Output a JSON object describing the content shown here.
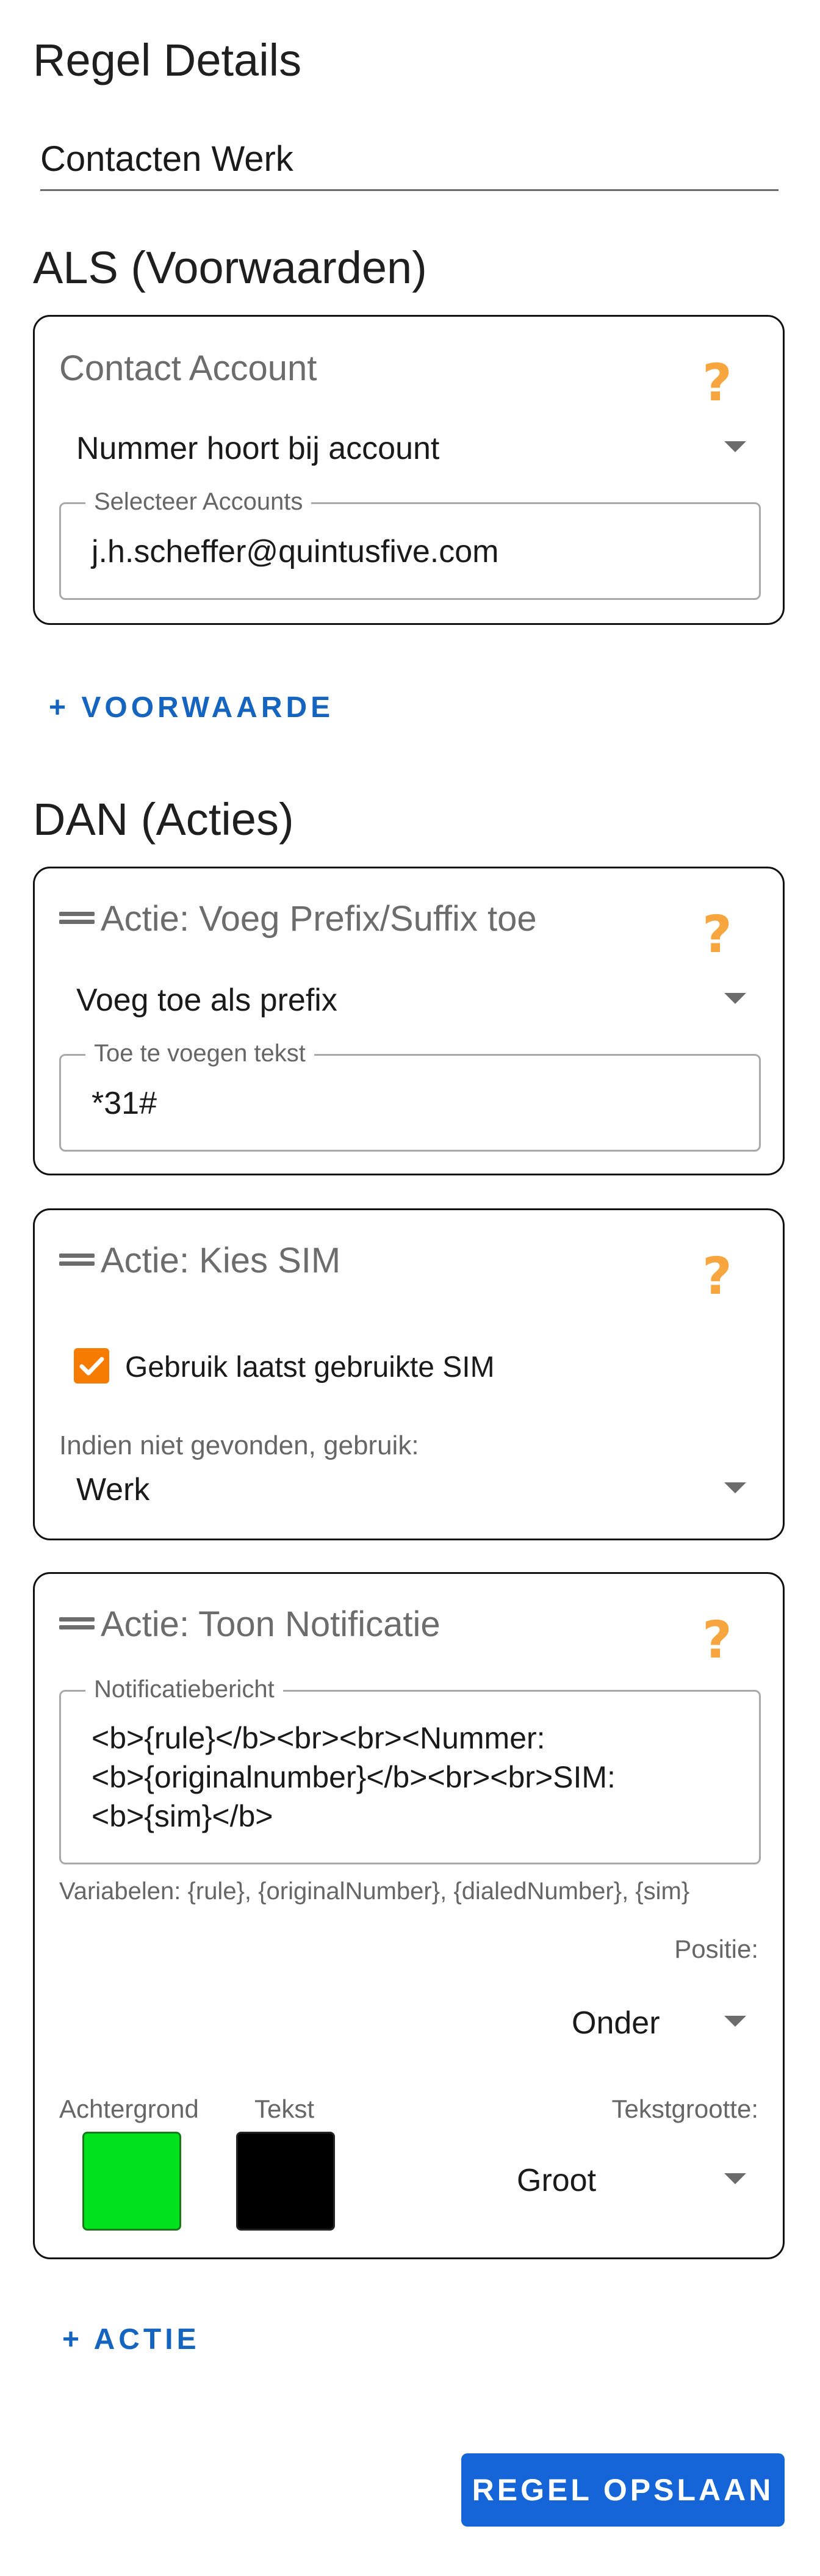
{
  "page": {
    "title": "Regel Details"
  },
  "rule_name": {
    "value": "Contacten Werk"
  },
  "conditions": {
    "title": "ALS (Voorwaarden)",
    "add_label": "+ VOORWAARDE",
    "card": {
      "title": "Contact Account",
      "help_icon": "question-mark-icon",
      "select_value": "Nummer hoort bij account",
      "field_label": "Selecteer Accounts",
      "field_value": "j.h.scheffer@quintusfive.com"
    }
  },
  "actions": {
    "title": "DAN (Acties)",
    "add_label": "+ ACTIE",
    "prefix": {
      "title": "Actie: Voeg Prefix/Suffix toe",
      "select_value": "Voeg toe als prefix",
      "field_label": "Toe te voegen tekst",
      "field_value": "*31#"
    },
    "sim": {
      "title": "Actie: Kies SIM",
      "checkbox_label": "Gebruik laatst gebruikte SIM",
      "checkbox_checked": true,
      "fallback_label": "Indien niet gevonden, gebruik:",
      "fallback_value": "Werk"
    },
    "notification": {
      "title": "Actie: Toon Notificatie",
      "message_label": "Notificatiebericht",
      "message_line1": "<b>{rule}</b><br><br><Nummer:",
      "message_line2": "<b>{originalnumber}</b><br><br>SIM:",
      "message_line3": "<b>{sim}</b>",
      "variables_hint": "Variabelen: {rule}, {originalNumber}, {dialedNumber}, {sim}",
      "position_label": "Positie:",
      "position_value": "Onder",
      "background_label": "Achtergrond",
      "text_label": "Tekst",
      "background_color": "#00e01d",
      "text_color": "#000000",
      "text_size_label": "Tekstgrootte:",
      "text_size_value": "Groot"
    }
  },
  "save_label": "REGEL OPSLAAN",
  "colors": {
    "accent": "#1565d8",
    "help": "#f6a53f",
    "checkbox": "#f57c00"
  }
}
